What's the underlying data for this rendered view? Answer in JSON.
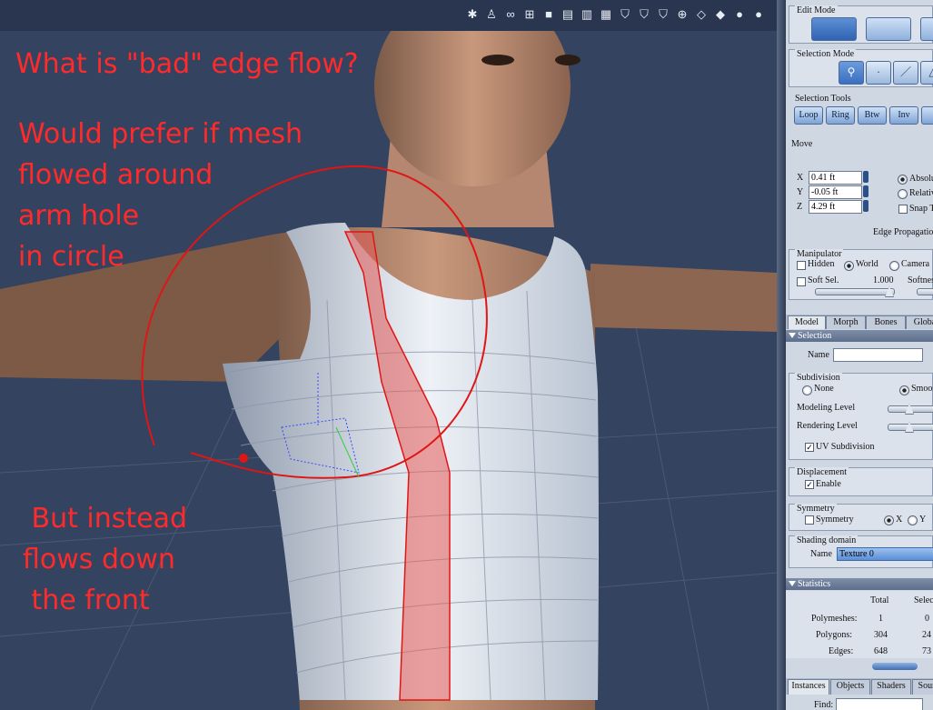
{
  "annotations": {
    "line1": "What is \"bad\" edge flow?",
    "line2": "Would prefer if mesh\nflowed around\narm hole\nin circle",
    "line3": " But instead\nflows down\n the front"
  },
  "viewport": {
    "toolbar_icons": [
      "sphere-tool-icon",
      "figure-icon",
      "chain-icon",
      "grid-icon",
      "single-view-icon",
      "two-view-icon",
      "three-view-icon",
      "four-view-icon",
      "shield-a-icon",
      "shield-b-icon",
      "shield-c-icon",
      "crosshair-icon",
      "cube-outline-icon",
      "cube-solid-icon",
      "sphere-white-icon",
      "sphere-gray-icon"
    ]
  },
  "panel": {
    "edit_mode": {
      "label": "Edit Mode"
    },
    "selection_mode": {
      "label": "Selection Mode"
    },
    "selection_tools": {
      "label": "Selection Tools",
      "loop": "Loop",
      "ring": "Ring",
      "btw": "Btw",
      "inv": "Inv"
    },
    "move": {
      "label": "Move"
    },
    "coords": {
      "x_label": "X",
      "x": "0.41 ft",
      "y_label": "Y",
      "y": "-0.05 ft",
      "z_label": "Z",
      "z": "4.29 ft"
    },
    "abs_rel": {
      "absolute": "Absolu",
      "relative": "Relativ",
      "snap": "Snap T"
    },
    "edge_propagation": "Edge Propagation",
    "manipulator": {
      "label": "Manipulator",
      "hidden": "Hidden",
      "world": "World",
      "camera": "Camera",
      "soft_sel": "Soft Sel.",
      "soft_value": "1.000",
      "softness": "Softnes"
    },
    "tabs": {
      "model": "Model",
      "morph": "Morph",
      "bones": "Bones",
      "global": "Globa"
    },
    "selection": {
      "header": "Selection",
      "name_label": "Name",
      "name_value": ""
    },
    "subdivision": {
      "label": "Subdivision",
      "none": "None",
      "smooth": "Smoot",
      "modeling_level": "Modeling Level",
      "rendering_level": "Rendering Level",
      "uv_subdivision": "UV Subdivision"
    },
    "displacement": {
      "label": "Displacement",
      "enable": "Enable"
    },
    "symmetry": {
      "label": "Symmetry",
      "symmetry": "Symmetry",
      "x": "X",
      "y": "Y"
    },
    "shading": {
      "label": "Shading domain",
      "name_label": "Name",
      "value": "Texture 0"
    },
    "statistics": {
      "header": "Statistics",
      "col_total": "Total",
      "col_selected": "Selec",
      "rows": [
        {
          "label": "Polymeshes:",
          "total": "1",
          "selected": "0"
        },
        {
          "label": "Polygons:",
          "total": "304",
          "selected": "24"
        },
        {
          "label": "Edges:",
          "total": "648",
          "selected": "73"
        }
      ]
    },
    "bottom_tabs": {
      "instances": "Instances",
      "objects": "Objects",
      "shaders": "Shaders",
      "source": "Sour"
    },
    "find_label": "Find:"
  }
}
